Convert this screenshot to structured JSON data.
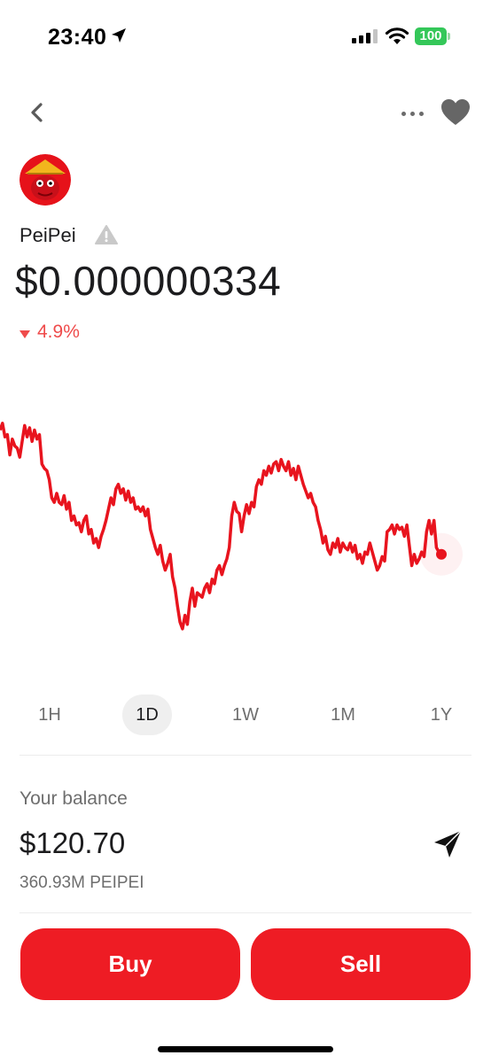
{
  "status_bar": {
    "time": "23:40",
    "battery": "100",
    "battery_color": "#34c759"
  },
  "nav": {
    "back_icon": "chevron-left-icon",
    "more_icon": "ellipsis-icon",
    "favorite_icon": "heart-icon"
  },
  "token": {
    "name": "PeiPei",
    "price": "$0.000000334",
    "change": "4.9%",
    "change_direction": "down",
    "change_color": "#ef4b4b"
  },
  "chart_data": {
    "type": "line",
    "line_color": "#e8141e",
    "range": "1D",
    "values": [
      0.9,
      0.93,
      0.87,
      0.88,
      0.79,
      0.86,
      0.83,
      0.82,
      0.78,
      0.85,
      0.92,
      0.87,
      0.91,
      0.85,
      0.9,
      0.86,
      0.88,
      0.75,
      0.73,
      0.72,
      0.68,
      0.6,
      0.58,
      0.62,
      0.58,
      0.57,
      0.61,
      0.55,
      0.58,
      0.5,
      0.52,
      0.48,
      0.49,
      0.45,
      0.5,
      0.52,
      0.44,
      0.46,
      0.4,
      0.42,
      0.38,
      0.43,
      0.46,
      0.5,
      0.55,
      0.6,
      0.57,
      0.64,
      0.66,
      0.62,
      0.64,
      0.59,
      0.63,
      0.58,
      0.6,
      0.55,
      0.56,
      0.54,
      0.56,
      0.52,
      0.55,
      0.46,
      0.42,
      0.38,
      0.35,
      0.39,
      0.32,
      0.28,
      0.31,
      0.35,
      0.25,
      0.2,
      0.12,
      0.05,
      0.02,
      0.08,
      0.04,
      0.14,
      0.2,
      0.12,
      0.18,
      0.17,
      0.16,
      0.2,
      0.22,
      0.18,
      0.24,
      0.22,
      0.28,
      0.3,
      0.26,
      0.3,
      0.33,
      0.38,
      0.52,
      0.58,
      0.54,
      0.53,
      0.45,
      0.52,
      0.57,
      0.53,
      0.58,
      0.56,
      0.65,
      0.68,
      0.66,
      0.72,
      0.7,
      0.74,
      0.71,
      0.75,
      0.76,
      0.72,
      0.77,
      0.74,
      0.72,
      0.76,
      0.7,
      0.73,
      0.68,
      0.74,
      0.7,
      0.66,
      0.63,
      0.6,
      0.62,
      0.58,
      0.56,
      0.5,
      0.46,
      0.4,
      0.43,
      0.37,
      0.35,
      0.4,
      0.38,
      0.42,
      0.36,
      0.4,
      0.38,
      0.37,
      0.4,
      0.36,
      0.39,
      0.33,
      0.35,
      0.31,
      0.36,
      0.35,
      0.4,
      0.36,
      0.32,
      0.28,
      0.3,
      0.34,
      0.32,
      0.45,
      0.46,
      0.48,
      0.44,
      0.48,
      0.46,
      0.47,
      0.43,
      0.48,
      0.39,
      0.3,
      0.35,
      0.31,
      0.33,
      0.36,
      0.34,
      0.45,
      0.5,
      0.44,
      0.5,
      0.38,
      0.36,
      0.35
    ]
  },
  "tabs": [
    {
      "label": "1H"
    },
    {
      "label": "1D"
    },
    {
      "label": "1W"
    },
    {
      "label": "1M"
    },
    {
      "label": "1Y"
    }
  ],
  "active_tab": "1D",
  "balance": {
    "label": "Your balance",
    "value": "$120.70",
    "units": "360.93M PEIPEI"
  },
  "actions": {
    "buy_label": "Buy",
    "sell_label": "Sell",
    "button_color": "#ee1c24",
    "send_icon": "paper-plane-icon"
  }
}
